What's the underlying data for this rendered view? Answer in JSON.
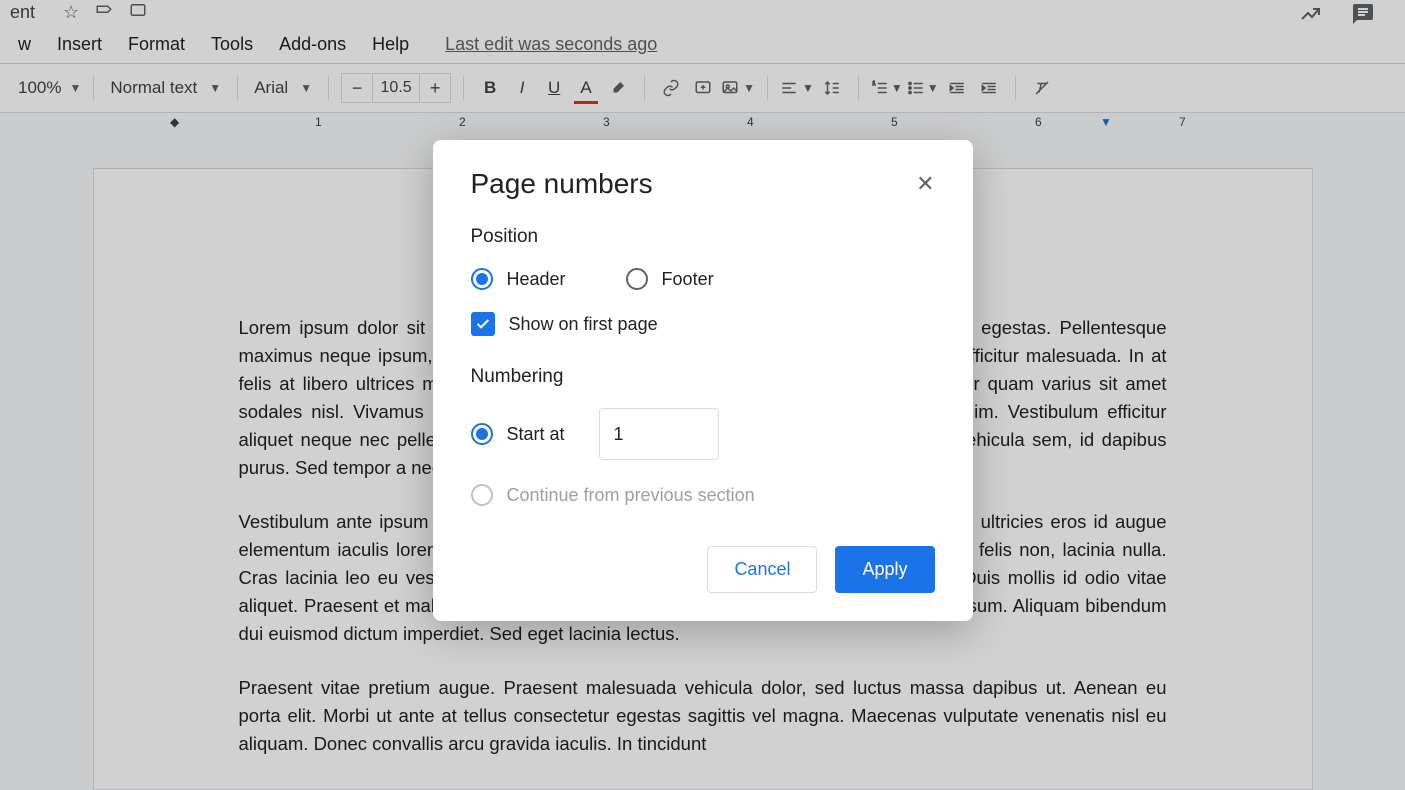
{
  "titlebar": {
    "doc_name": "ent"
  },
  "menubar": {
    "items": [
      "w",
      "Insert",
      "Format",
      "Tools",
      "Add-ons",
      "Help"
    ],
    "last_edit": "Last edit was seconds ago"
  },
  "toolbar": {
    "zoom": "100%",
    "paragraph_style": "Normal text",
    "font": "Arial",
    "font_size": "10.5"
  },
  "ruler": {
    "marks": [
      "1",
      "2",
      "3",
      "4",
      "5",
      "6",
      "7"
    ]
  },
  "doc": {
    "p1": "Lorem ipsum dolor sit amet, consectetur adipiscing elit. Aenean finibus magna blandit egestas. Pellentesque maximus neque ipsum, quis malesuada sapien convallis. Praesent aliquam ex vel mi efficitur malesuada. In at felis at libero ultrices mollis euismod ex. Aliquam semper malesuada sapien, at efficitur quam varius sit amet sodales nisl. Vivamus quis venenatis massa. Nunc blandit nulla nunc, eu tristique enim. Vestibulum efficitur aliquet neque nec pellentesque. Vivamus quis consequat, id vulputate vel. Sed eget vehicula sem, id dapibus purus. Sed tempor a neque vel mollis leo.",
    "p2": "Vestibulum ante ipsum primis in faucibus orci luctus et ultrices posuere curae; Vivamus ultricies eros id augue elementum iaculis lorem. Etiam et consectetur ultrices. Sed non ante imperdiet, viverra felis non, lacinia nulla. Cras lacinia leo eu vestibulum dapibus rutrum turpis, non fermentum dui lacinia nec. Duis mollis id odio vitae aliquet. Praesent et malesuada ante, vel elementum erat. Proin ac finibus consectetur ipsum. Aliquam bibendum dui euismod dictum imperdiet. Sed eget lacinia lectus.",
    "p3": "Praesent vitae pretium augue. Praesent malesuada vehicula dolor, sed luctus massa dapibus ut. Aenean eu porta elit. Morbi ut ante at tellus consectetur egestas sagittis vel magna. Maecenas vulputate venenatis nisl eu aliquam. Donec convallis arcu gravida iaculis. In tincidunt"
  },
  "dialog": {
    "title": "Page numbers",
    "position_label": "Position",
    "header_label": "Header",
    "footer_label": "Footer",
    "show_first_label": "Show on first page",
    "numbering_label": "Numbering",
    "start_at_label": "Start at",
    "start_at_value": "1",
    "continue_label": "Continue from previous section",
    "cancel": "Cancel",
    "apply": "Apply"
  }
}
